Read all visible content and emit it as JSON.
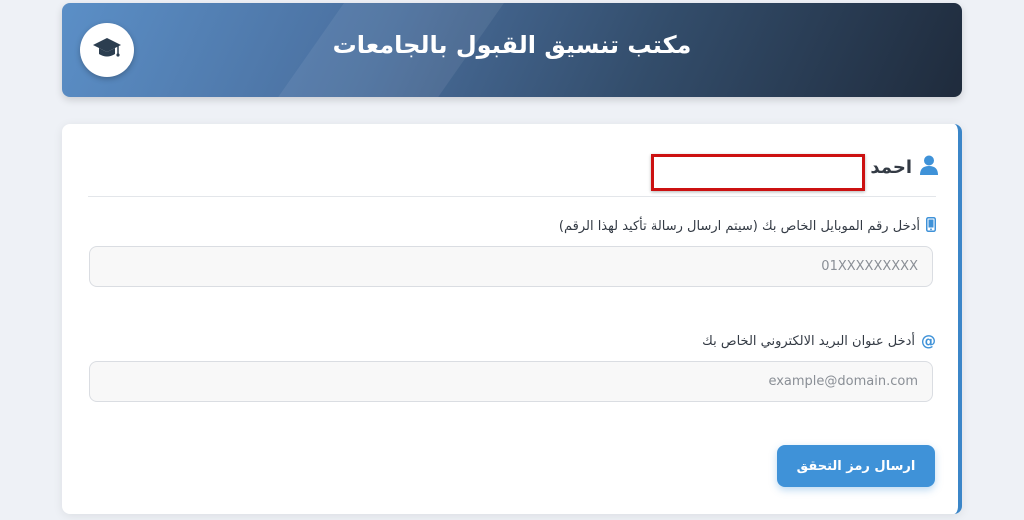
{
  "header": {
    "title": "مكتب تنسيق القبول بالجامعات",
    "logo_icon": "graduation-cap-icon"
  },
  "user": {
    "name": "احمد",
    "icon": "user-icon",
    "redacted": true
  },
  "form": {
    "mobile": {
      "icon": "mobile-phone-icon",
      "label": "أدخل رقم الموبايل الخاص بك (سيتم ارسال رسالة تأكيد لهذا الرقم)",
      "placeholder": "01XXXXXXXXX",
      "value": ""
    },
    "email": {
      "icon": "at-sign-icon",
      "label": "أدخل عنوان البريد الالكتروني الخاص بك",
      "placeholder": "example@domain.com",
      "value": ""
    },
    "submit_label": "ارسال رمز التحقق"
  },
  "colors": {
    "accent": "#3f92d8",
    "header_dark": "#1f2b3c",
    "redact_border": "#cc1111"
  }
}
